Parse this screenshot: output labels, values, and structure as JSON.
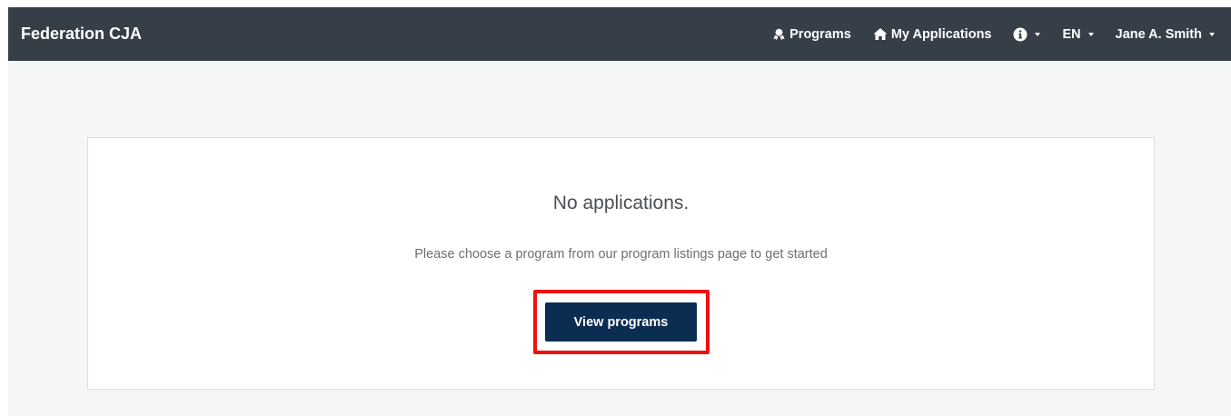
{
  "navbar": {
    "brand": "Federation CJA",
    "programs_label": "Programs",
    "programs_icon": "award-icon",
    "my_applications_label": "My Applications",
    "my_applications_icon": "home-icon",
    "info_icon": "info-circle-icon",
    "language_label": "EN",
    "user_label": "Jane A. Smith"
  },
  "main": {
    "empty_title": "No applications.",
    "empty_message": "Please choose a program from our program listings page to get started",
    "view_programs_label": "View programs"
  },
  "colors": {
    "navbar_bg": "#363f48",
    "page_bg": "#f5f7f7",
    "button_bg": "#0b2d52",
    "highlight": "#ee1111"
  }
}
